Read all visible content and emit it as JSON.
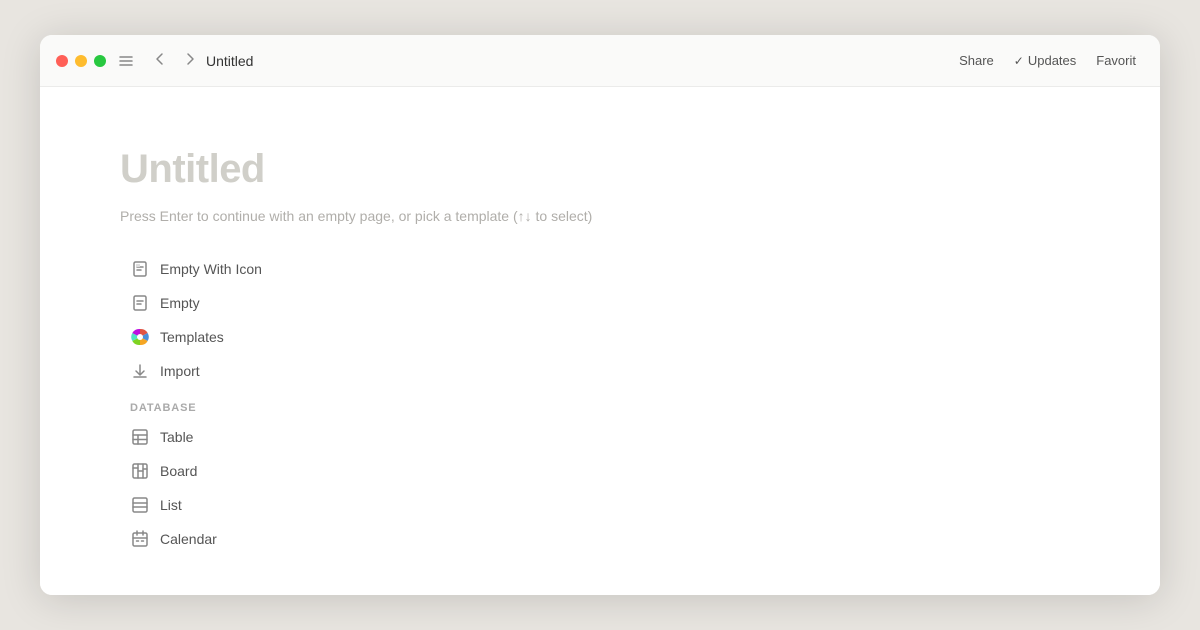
{
  "titlebar": {
    "title": "Untitled",
    "share_label": "Share",
    "updates_label": "Updates",
    "favorites_label": "Favorit"
  },
  "page": {
    "heading": "Untitled",
    "hint": "Press Enter to continue with an empty page, or pick a template (↑↓ to select)"
  },
  "templates": [
    {
      "id": "empty-with-icon",
      "label": "Empty With Icon",
      "icon": "page-icon"
    },
    {
      "id": "empty",
      "label": "Empty",
      "icon": "page-empty-icon"
    },
    {
      "id": "templates",
      "label": "Templates",
      "icon": "templates-colorful-icon"
    },
    {
      "id": "import",
      "label": "Import",
      "icon": "download-icon"
    }
  ],
  "database_section_label": "DATABASE",
  "database_items": [
    {
      "id": "table",
      "label": "Table",
      "icon": "table-icon"
    },
    {
      "id": "board",
      "label": "Board",
      "icon": "board-icon"
    },
    {
      "id": "list",
      "label": "List",
      "icon": "list-icon"
    },
    {
      "id": "calendar",
      "label": "Calendar",
      "icon": "calendar-icon"
    }
  ]
}
